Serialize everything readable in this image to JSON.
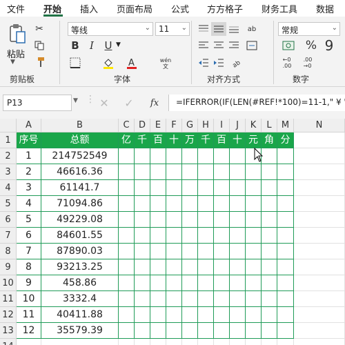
{
  "ribbon_tabs": [
    {
      "label": "文件",
      "active": false
    },
    {
      "label": "开始",
      "active": true
    },
    {
      "label": "插入",
      "active": false
    },
    {
      "label": "页面布局",
      "active": false
    },
    {
      "label": "公式",
      "active": false
    },
    {
      "label": "方方格子",
      "active": false
    },
    {
      "label": "财务工具",
      "active": false
    },
    {
      "label": "数据",
      "active": false
    }
  ],
  "ribbon": {
    "clipboard": {
      "paste_label": "粘贴",
      "group_label": "剪贴板"
    },
    "font": {
      "font_name": "等线",
      "font_size": "11",
      "group_label": "字体",
      "wen_label": "wén\n文"
    },
    "alignment": {
      "group_label": "对齐方式"
    },
    "number": {
      "format": "常规",
      "group_label": "数字"
    }
  },
  "formula_bar": {
    "name_box": "P13",
    "fx": "fx",
    "formula": "=IFERROR(IF(LEN(#REF!*100)=11-1,\" ¥ \","
  },
  "sheet": {
    "columns": [
      "A",
      "B",
      "C",
      "D",
      "E",
      "F",
      "G",
      "H",
      "I",
      "J",
      "K",
      "L",
      "M",
      "N"
    ],
    "header_row": [
      "序号",
      "总额",
      "亿",
      "千",
      "百",
      "十",
      "万",
      "千",
      "百",
      "十",
      "元",
      "角",
      "分"
    ],
    "rows": [
      {
        "num": "1",
        "amount": "214752549"
      },
      {
        "num": "2",
        "amount": "46616.36"
      },
      {
        "num": "3",
        "amount": "61141.7"
      },
      {
        "num": "4",
        "amount": "71094.86"
      },
      {
        "num": "5",
        "amount": "49229.08"
      },
      {
        "num": "6",
        "amount": "84601.55"
      },
      {
        "num": "7",
        "amount": "87890.03"
      },
      {
        "num": "8",
        "amount": "93213.25"
      },
      {
        "num": "9",
        "amount": "458.86"
      },
      {
        "num": "10",
        "amount": "3332.4"
      },
      {
        "num": "11",
        "amount": "40411.88"
      },
      {
        "num": "12",
        "amount": "35579.39"
      }
    ],
    "row_numbers": [
      "1",
      "2",
      "3",
      "4",
      "5",
      "6",
      "7",
      "8",
      "9",
      "10",
      "11",
      "12",
      "13",
      "14"
    ]
  },
  "colors": {
    "accent": "#217346",
    "header_fill": "#1aa64a",
    "border": "#1f9b57"
  }
}
